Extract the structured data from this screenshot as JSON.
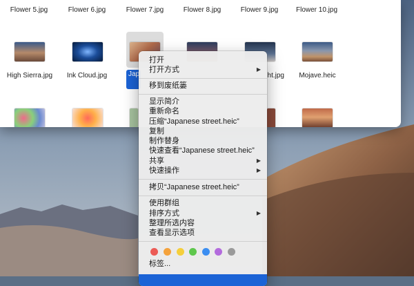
{
  "finder": {
    "top_row_labels": [
      "Flower 5.jpg",
      "Flower 6.jpg",
      "Flower 7.jpg",
      "Flower 8.jpg",
      "Flower 9.jpg",
      "Flower 10.jpg"
    ],
    "files": [
      {
        "label": "High Sierra.jpg"
      },
      {
        "label": "Ink Cloud.jpg"
      },
      {
        "label": "Japanese street.heic",
        "selected": true,
        "visible_label": "Jap stre"
      },
      {
        "label": "ht.jpg"
      },
      {
        "label": "Mojave.heic"
      }
    ]
  },
  "context_menu": {
    "open": "打开",
    "open_with": "打开方式",
    "move_to_trash": "移到废纸篓",
    "get_info": "显示简介",
    "rename": "重新命名",
    "compress": "压缩“Japanese street.heic”",
    "duplicate": "复制",
    "make_alias": "制作替身",
    "quick_look": "快速查看“Japanese street.heic”",
    "share": "共享",
    "quick_actions": "快速操作",
    "copy": "拷贝“Japanese street.heic”",
    "use_groups": "使用群组",
    "sort_by": "排序方式",
    "clean_up_selection": "整理所选内容",
    "show_view_options": "查看显示选项",
    "tags": "标签...",
    "tag_colors": [
      "#ec5b56",
      "#f4a23c",
      "#f5cf3b",
      "#5ec74c",
      "#3c8ef1",
      "#b36bdd",
      "#9a9a9a"
    ]
  }
}
